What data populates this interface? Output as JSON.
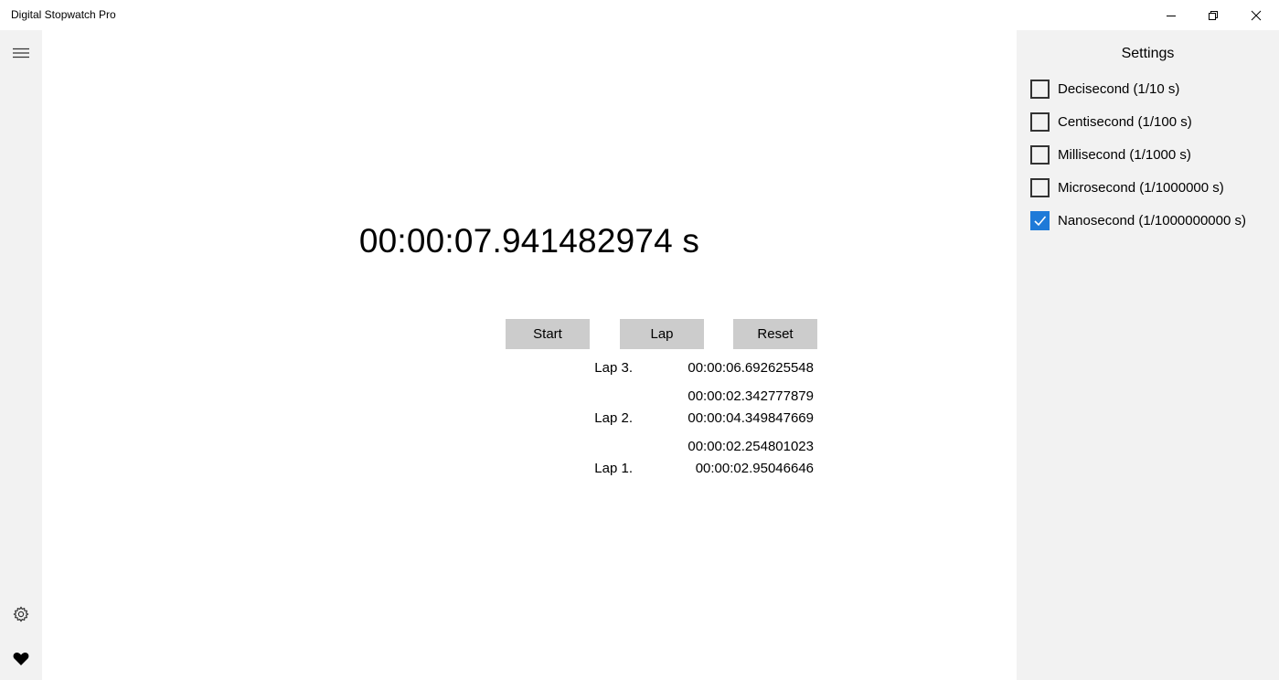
{
  "window": {
    "title": "Digital Stopwatch Pro",
    "controls": [
      "minimize-icon",
      "restore-icon",
      "close-icon"
    ]
  },
  "rail": {
    "icons": [
      "hamburger-menu-icon",
      "gear-icon",
      "heart-icon"
    ]
  },
  "stopwatch": {
    "display": "00:00:07.941482974 s",
    "buttons": {
      "start": "Start",
      "lap": "Lap",
      "reset": "Reset"
    },
    "laps": [
      {
        "label": "Lap 3.",
        "total": "00:00:06.692625548"
      },
      {
        "split": "00:00:02.342777879"
      },
      {
        "label": "Lap 2.",
        "total": "00:00:04.349847669"
      },
      {
        "split": "00:00:02.254801023"
      },
      {
        "label": "Lap 1.",
        "total": "00:00:02.95046646"
      }
    ]
  },
  "settings": {
    "title": "Settings",
    "options": [
      {
        "label": "Decisecond (1/10 s)",
        "checked": false
      },
      {
        "label": "Centisecond (1/100 s)",
        "checked": false
      },
      {
        "label": "Millisecond (1/1000 s)",
        "checked": false
      },
      {
        "label": "Microsecond (1/1000000 s)",
        "checked": false
      },
      {
        "label": "Nanosecond (1/1000000000 s)",
        "checked": true
      }
    ],
    "accent": "#1e7ad8"
  }
}
